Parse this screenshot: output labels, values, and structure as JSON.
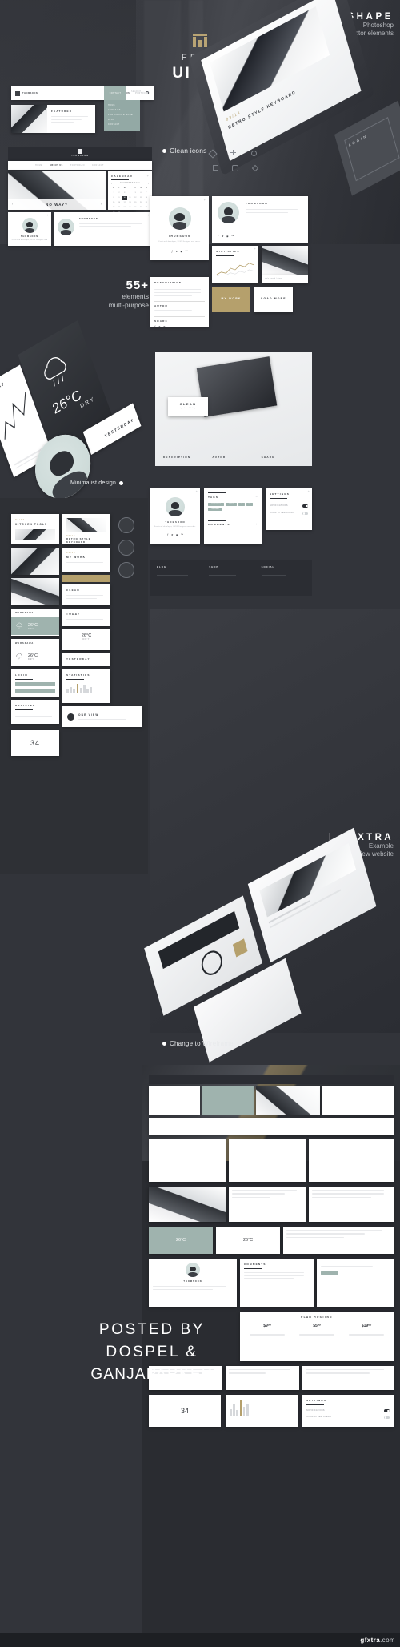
{
  "poster": {
    "background_color": "#32343a",
    "accent_gold": "#b9a474",
    "accent_sage": "#9fb3ae"
  },
  "hero": {
    "logo_icon": "book-mark-icon",
    "eyebrow": "FREE",
    "title": "UI KIT",
    "shape": {
      "title": "SHAPE",
      "sub1": "Photoshop",
      "sub2": "vector elements"
    },
    "device_label": "03/14",
    "device_title": "RETRO STYLE KEYBOARD",
    "login_label": "LOGIN"
  },
  "navbar": {
    "brand": "THOMSOON",
    "links": [
      "HOME",
      "ABOUT US",
      "PORTFOLIO",
      "CONTACT"
    ],
    "active_link": "ABOUT US",
    "highlight_link": "CONTACT",
    "search_placeholder": "SEARCH...",
    "search_icon": "search-icon"
  },
  "dropdown": {
    "items": [
      "HOME",
      "ABOUT US",
      "PORTFOLIO & MORE",
      "BLOG",
      "CONTACT"
    ]
  },
  "cards": {
    "featured_title": "FEATURED",
    "noway_title": "NO WAY?",
    "calendar_title": "CALENDAR",
    "calendar_month": "NOVEMBER 2014",
    "calendar_daynames": [
      "M",
      "T",
      "W",
      "T",
      "F",
      "S",
      "S"
    ],
    "calendar_selected": "10",
    "profile_name": "THOMSOON",
    "profile_desc": "Front-end developer, UI/UX Designer and coder.",
    "social_icons": [
      "facebook-icon",
      "twitter-icon",
      "instagram-icon",
      "behance-icon"
    ],
    "statistics_title": "STATISTICS",
    "description_title": "DESCRIPTION",
    "autor_title": "AUTOR",
    "share_title": "SHARE",
    "my_work_button": "MY WORK",
    "load_more_button": "LOAD MORE",
    "clean_label": "CLEAN",
    "clean_sub": "style / mood / shape",
    "tags_title": "TAGS",
    "tags": [
      "WORDPRESS",
      "THEME",
      "UI",
      "UX",
      "TEMPLATE"
    ],
    "comments_title": "COMMENTS",
    "settings_title": "SETTINGS",
    "settings_rows": [
      "NOTIFICATIONS",
      "SHOW OTHER USERS"
    ],
    "login_title": "LOGIN",
    "register_title": "REGISTER",
    "one_view_title": "ONE VIEW",
    "plan_title": "PLAN HOSTING",
    "prices": [
      "$9⁰⁰",
      "$5⁰⁰",
      "$19⁰⁰"
    ],
    "kitchen_title": "KITCHEN TOOLS",
    "kitchen_code": "01/14",
    "retro_title": "RETRO STYLE KEYBOARD",
    "retro_code": "03/14",
    "mywork_code": "03/14",
    "mywork_title": "MY WORK",
    "weather_city1": "WARSZAWA",
    "weather_city2": "WARSZAWA",
    "weather_temp": "26°C",
    "weather_state": "DRY",
    "today_label": "TODAY",
    "yesterday_label": "YESTERDAY",
    "number_card": "34",
    "blog_label": "BLOG",
    "shop_label": "SHOP",
    "social_label": "SOCIAL"
  },
  "labels": {
    "clean_icons": "Clean icons",
    "count_number": "55+",
    "count_line1": "elements",
    "count_line2": "multi-purpose",
    "minimalist": "Minimalist design",
    "wireframe": "Change to Wireframe"
  },
  "extra": {
    "title": "EXTRA",
    "sub1": "Example",
    "sub2": "preview website"
  },
  "credit": {
    "line1": "POSTED BY",
    "line2": "DOSPEL  &",
    "line3": "GANJAPARKER"
  },
  "footer": {
    "brand_prefix": "gfxtra",
    "brand_suffix": ".com"
  }
}
